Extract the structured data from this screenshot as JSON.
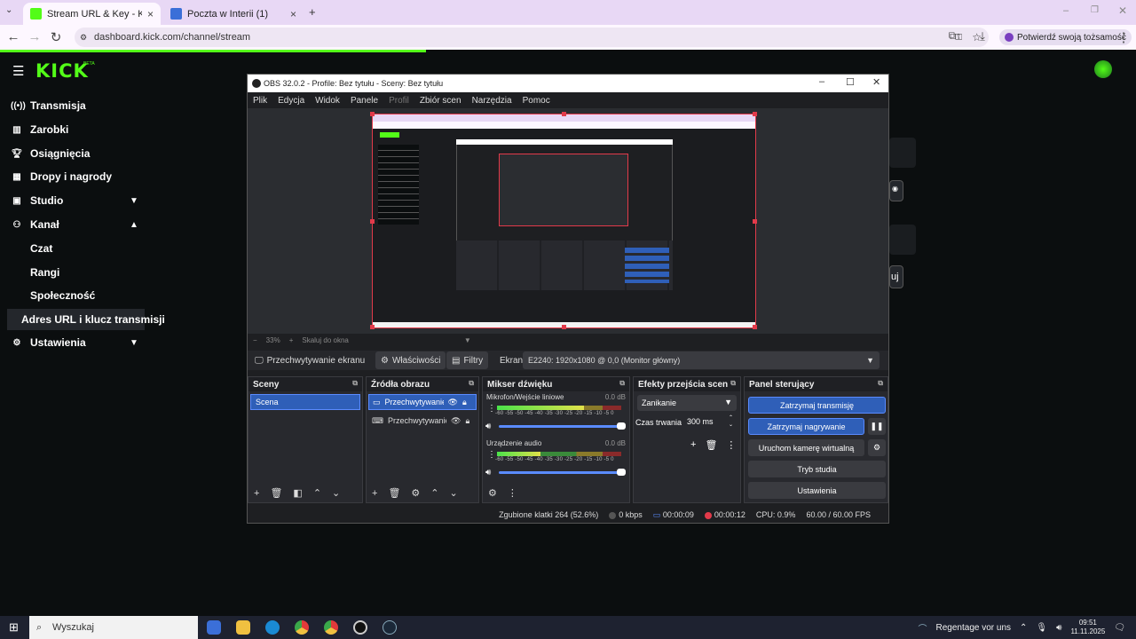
{
  "browser": {
    "tabs": [
      {
        "title": "Stream URL & Key - Kick Dashb",
        "active": true
      },
      {
        "title": "Poczta w Interii (1)",
        "active": false
      }
    ],
    "url": "dashboard.kick.com/channel/stream",
    "verify_label": "Potwierdź swoją tożsamość"
  },
  "kick": {
    "logo": "KICK",
    "beta": "BETA",
    "sidebar": [
      {
        "label": "Transmisja",
        "icon": "broadcast-icon"
      },
      {
        "label": "Zarobki",
        "icon": "earnings-icon"
      },
      {
        "label": "Osiągnięcia",
        "icon": "trophy-icon"
      },
      {
        "label": "Dropy i nagrody",
        "icon": "gift-icon"
      },
      {
        "label": "Studio",
        "icon": "studio-icon"
      },
      {
        "label": "Kanał",
        "icon": "channel-icon"
      }
    ],
    "channel_sub": [
      "Czat",
      "Rangi",
      "Społeczność",
      "Adres URL i klucz transmisji"
    ],
    "settings_label": "Ustawienia",
    "right_button_partial": "uj"
  },
  "obs": {
    "title": "OBS 32.0.2 - Profile: Bez tytułu - Sceny: Bez tytułu",
    "menu": [
      "Plik",
      "Edycja",
      "Widok",
      "Panele",
      "Profil",
      "Zbiór scen",
      "Narzędzia",
      "Pomoc"
    ],
    "zoom": "33%",
    "scale_label": "Skaluj do okna",
    "source_name": "Przechwytywanie ekranu",
    "properties_label": "Właściwości",
    "filters_label": "Filtry",
    "screen_label": "Ekran",
    "screen_value": "E2240: 1920x1080 @ 0,0 (Monitor główny)",
    "docks": {
      "scenes": {
        "title": "Sceny",
        "items": [
          "Scena"
        ]
      },
      "sources": {
        "title": "Źródła obrazu",
        "items": [
          "Przechwytywanie",
          "Przechwytywanie"
        ]
      },
      "mixer": {
        "title": "Mikser dźwięku",
        "channels": [
          {
            "name": "Mikrofon/Wejście liniowe",
            "db": "0.0 dB",
            "level": 0.7
          },
          {
            "name": "Urządzenie audio",
            "db": "0.0 dB",
            "level": 0.35
          }
        ],
        "ticks": "-60 -55 -50 -45 -40 -35 -30 -25 -20 -15 -10 -5 0"
      },
      "transitions": {
        "title": "Efekty przejścia scen",
        "type": "Zanikanie",
        "duration_label": "Czas trwania",
        "duration": "300 ms"
      },
      "controls": {
        "title": "Panel sterujący",
        "buttons": [
          "Zatrzymaj transmisję",
          "Zatrzymaj nagrywanie",
          "Uruchom kamerę wirtualną",
          "Tryb studia",
          "Ustawienia"
        ]
      }
    },
    "status": {
      "dropped": "Zgubione klatki 264 (52.6%)",
      "kbps": "0 kbps",
      "stream_time": "00:00:09",
      "rec_time": "00:00:12",
      "cpu": "CPU: 0.9%",
      "fps": "60.00 / 60.00 FPS"
    }
  },
  "taskbar": {
    "search": "Wyszukaj",
    "notification": "Regentage vor uns",
    "time": "09:51",
    "date": "11.11.2025"
  },
  "colors": {
    "kick_green": "#53fc18",
    "obs_blue": "#2f5fb8",
    "capture_border": "#e23a4a"
  }
}
